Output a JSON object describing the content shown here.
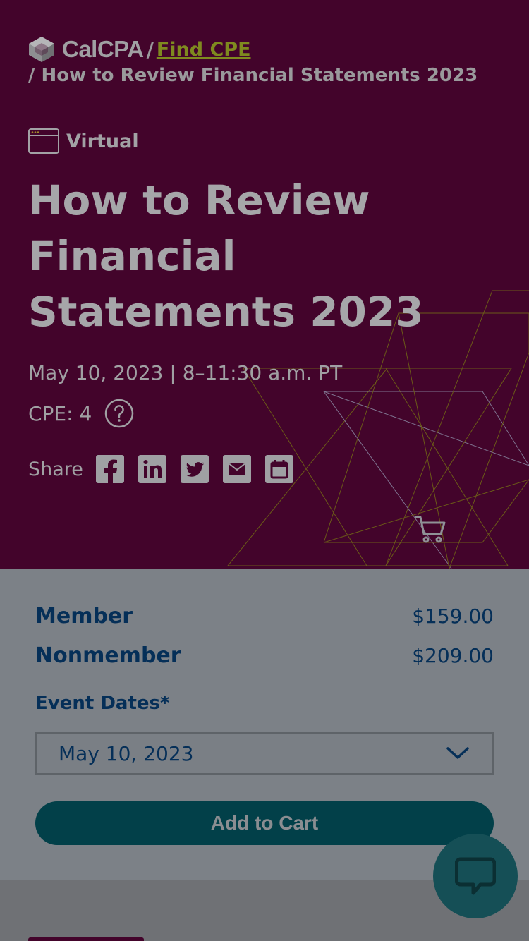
{
  "breadcrumb": {
    "logo_text": "CalCPA",
    "separator": "/",
    "link_label": "Find CPE",
    "current": "/ How to Review Financial Statements 2023"
  },
  "event": {
    "format": "Virtual",
    "title": "How to Review Financial Statements 2023",
    "date_time": "May 10, 2023 | 8–11:30 a.m. PT",
    "cpe": "CPE: 4",
    "share_label": "Share"
  },
  "share_icons": [
    "facebook-icon",
    "linkedin-icon",
    "twitter-icon",
    "email-icon",
    "calendar-icon"
  ],
  "pricing": {
    "member_label": "Member",
    "member_price": "$159.00",
    "nonmember_label": "Nonmember",
    "nonmember_price": "$209.00"
  },
  "event_dates": {
    "label": "Event Dates*",
    "selected": "May 10, 2023"
  },
  "actions": {
    "add_to_cart": "Add to Cart"
  },
  "colors": {
    "hero_bg": "#43042b",
    "panel_bg": "#7c8187",
    "primary_text": "#052f58",
    "button_bg": "#024049",
    "link": "#7f8a1f"
  }
}
